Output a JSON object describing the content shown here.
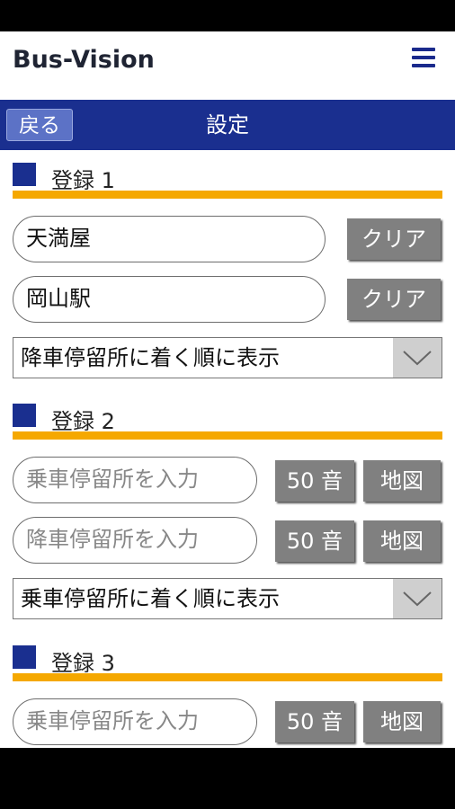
{
  "app": {
    "logo": "Bus-Vision",
    "menu_icon": "hamburger-menu-icon"
  },
  "titlebar": {
    "back_label": "戻る",
    "title": "設定"
  },
  "colors": {
    "navy": "#1a2f8f",
    "orange": "#f5a800",
    "button_gray": "#808080"
  },
  "sections": [
    {
      "heading": "登録 1",
      "from_value": "天満屋",
      "to_value": "岡山駅",
      "clear_label": "クリア",
      "sort_value": "降車停留所に着く順に表示"
    },
    {
      "heading": "登録 2",
      "from_placeholder": "乗車停留所を入力",
      "to_placeholder": "降車停留所を入力",
      "kana_label": "50 音",
      "map_label": "地図",
      "sort_value": "乗車停留所に着く順に表示"
    },
    {
      "heading": "登録 3",
      "from_placeholder": "乗車停留所を入力",
      "kana_label": "50 音",
      "map_label": "地図"
    }
  ]
}
